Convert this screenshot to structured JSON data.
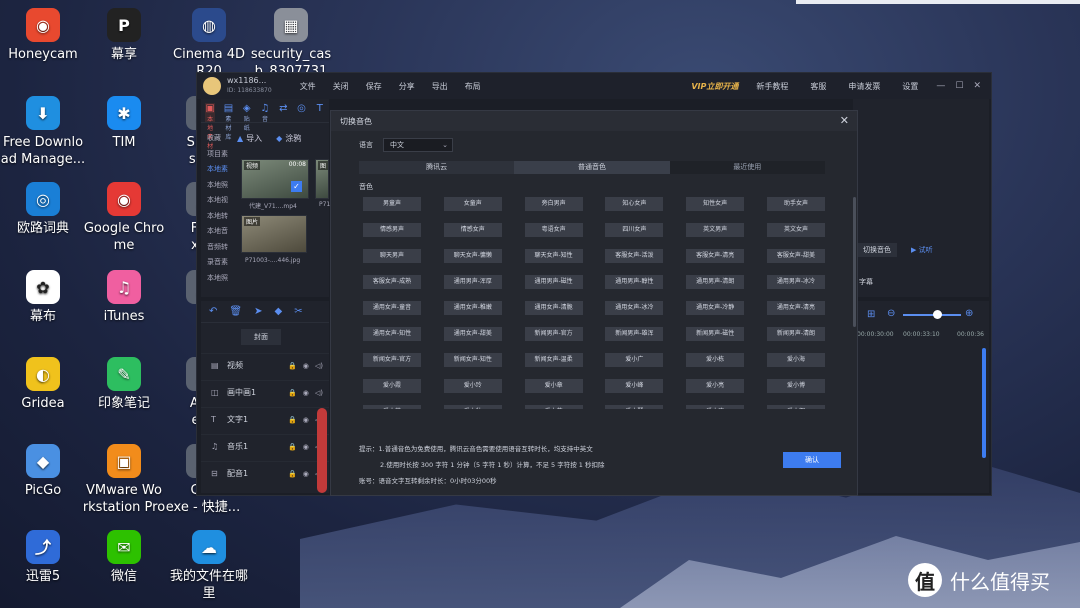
{
  "desktop": {
    "icons": [
      {
        "label": "Honeycam",
        "glyph": "◉",
        "color": "#e8492f"
      },
      {
        "label": "Free Downlo\nad Manage...",
        "glyph": "⬇",
        "color": "#1f8fe0"
      },
      {
        "label": "欧路词典",
        "glyph": "◎",
        "color": "#1a7fd6"
      },
      {
        "label": "幕布",
        "glyph": "✿",
        "color": "#ffffff"
      },
      {
        "label": "Gridea",
        "glyph": "◐",
        "color": "#f0c21c"
      },
      {
        "label": "PicGo",
        "glyph": "◆",
        "color": "#4a90e2"
      },
      {
        "label": "迅雷5",
        "glyph": "⤴",
        "color": "#2f6bd8"
      },
      {
        "label": "幕享",
        "glyph": "P",
        "color": "#222222"
      },
      {
        "label": "TIM",
        "glyph": "✱",
        "color": "#1a8bf0"
      },
      {
        "label": "Google Chro\nme",
        "glyph": "◉",
        "color": "#e53935"
      },
      {
        "label": "iTunes",
        "glyph": "♫",
        "color": "#f05fa0"
      },
      {
        "label": "印象笔记",
        "glyph": "✎",
        "color": "#2dbe60"
      },
      {
        "label": "VMware Wo\nrkstation Pro",
        "glyph": "▣",
        "color": "#f28c1b"
      },
      {
        "label": "微信",
        "glyph": "✉",
        "color": "#2dc100"
      },
      {
        "label": "Cinema 4D\nR20",
        "glyph": "◍",
        "color": "#2b4a8c"
      },
      {
        "label": "security_cas\nb_8307731",
        "glyph": "▦",
        "color": "#8a8f99"
      },
      {
        "label": "Shad\nsR-d",
        "glyph": "▲",
        "color": "#5a6270"
      },
      {
        "label": "FSC\nxe -",
        "glyph": "▲",
        "color": "#5a6270"
      },
      {
        "label": "E",
        "glyph": "▲",
        "color": "#5a6270"
      },
      {
        "label": "Arct\nexe",
        "glyph": "▲",
        "color": "#5a6270"
      },
      {
        "label": "CRT\nexe - 快捷...",
        "glyph": "▲",
        "color": "#5a6270"
      },
      {
        "label": "我的文件在哪\n里",
        "glyph": "☁",
        "color": "#1f8fe0"
      }
    ],
    "watermark": {
      "circle": "值",
      "text": "什么值得买"
    }
  },
  "app": {
    "user": {
      "name": "wx1186...",
      "id": "ID: 118633870"
    },
    "menu": [
      "文件",
      "关闭",
      "保存",
      "分享",
      "导出",
      "布局"
    ],
    "right_menu": {
      "vip": "VIP立即开通",
      "items": [
        "新手教程",
        "客服",
        "申请发票",
        "设置"
      ]
    },
    "window_controls": [
      "—",
      "☐",
      "✕"
    ],
    "tool_tabs": [
      {
        "label": "本地素材",
        "glyph": "▣"
      },
      {
        "label": "素材库",
        "glyph": "▤"
      },
      {
        "label": "贴纸",
        "glyph": "◈"
      },
      {
        "label": "音",
        "glyph": "♫"
      },
      {
        "label": "",
        "glyph": "⇄"
      },
      {
        "label": "",
        "glyph": "◎"
      },
      {
        "label": "",
        "glyph": "T"
      }
    ],
    "side_list": [
      "收藏",
      "项目素",
      "本地素",
      "本地照",
      "本地视",
      "本地转",
      "本地音",
      "音频转",
      "录音素",
      "本地照"
    ],
    "import": {
      "import_label": "导入",
      "paint_label": "涂鸦"
    },
    "media": [
      {
        "tag": "视频",
        "duration": "00:08",
        "caption": "代建_V71....mp4"
      },
      {
        "tag": "图",
        "duration": "",
        "caption": "P71"
      },
      {
        "tag": "图片",
        "duration": "",
        "caption": "P71003-....446.jpg"
      }
    ],
    "cover_label": "封面",
    "tracks": [
      {
        "name": "视频",
        "icon": "▤"
      },
      {
        "name": "画中画1",
        "icon": "◫"
      },
      {
        "name": "文字1",
        "icon": "T"
      },
      {
        "name": "音乐1",
        "icon": "♫"
      },
      {
        "name": "配音1",
        "icon": "⊟"
      }
    ],
    "right_pane": {
      "switch_voice": "切换音色",
      "audition": "▶ 试听",
      "subtitle": "字幕"
    },
    "timeline_ticks": [
      "00:00:30:00",
      "00:00:33:10",
      "00:00:36"
    ]
  },
  "dialog": {
    "title": "切换音色",
    "close": "✕",
    "language_label": "语言",
    "language_value": "中文",
    "tabs": [
      "腾讯云",
      "普通音色",
      "最近使用"
    ],
    "section_label": "音色",
    "voices": [
      "男童声",
      "女童声",
      "旁白男声",
      "知心女声",
      "知性女声",
      "助手女声",
      "情感男声",
      "情感女声",
      "粤语女声",
      "四川女声",
      "英文男声",
      "英文女声",
      "聊天男声",
      "聊天女声-慵懒",
      "聊天女声-知性",
      "客服女声-活泼",
      "客服女声-清亮",
      "客服女声-甜美",
      "客服女声-成熟",
      "通用男声-浑厚",
      "通用男声-磁性",
      "通用男声-醇性",
      "通用男声-清朗",
      "通用男声-冰冷",
      "通用女声-童音",
      "通用女声-稚嫩",
      "通用女声-清脆",
      "通用女声-冰冷",
      "通用女声-冷静",
      "通用女声-清亮",
      "通用女声-知性",
      "通用女声-甜美",
      "新闻男声-官方",
      "新闻男声-雄浑",
      "新闻男声-磁性",
      "新闻男声-清朗",
      "新闻女声-官方",
      "新闻女声-知性",
      "新闻女声-温柔",
      "爱小广",
      "爱小栋",
      "爱小海",
      "爱小霞",
      "爱小玲",
      "爱小章",
      "爱小峰",
      "爱小亮",
      "爱小博",
      "爱小芸",
      "爱小秋",
      "爱小芳",
      "爱小琴",
      "爱小康",
      "爱小辉"
    ],
    "tip1": "提示：1.普通音色为免费使用，腾讯云音色需要使用语音互转时长，均支持中英文",
    "tip2": "2.使用时长按 300 字符 1 分钟（5 字符 1 秒）计算，不足 5 字符按 1 秒扣除",
    "tip3": "账号：语音文字互转剩余时长：0小时03分00秒",
    "confirm": "确认"
  },
  "colors": {
    "accent": "#3d7cf0",
    "vip": "#e7b34a",
    "active_tab": "#e05a5a"
  }
}
